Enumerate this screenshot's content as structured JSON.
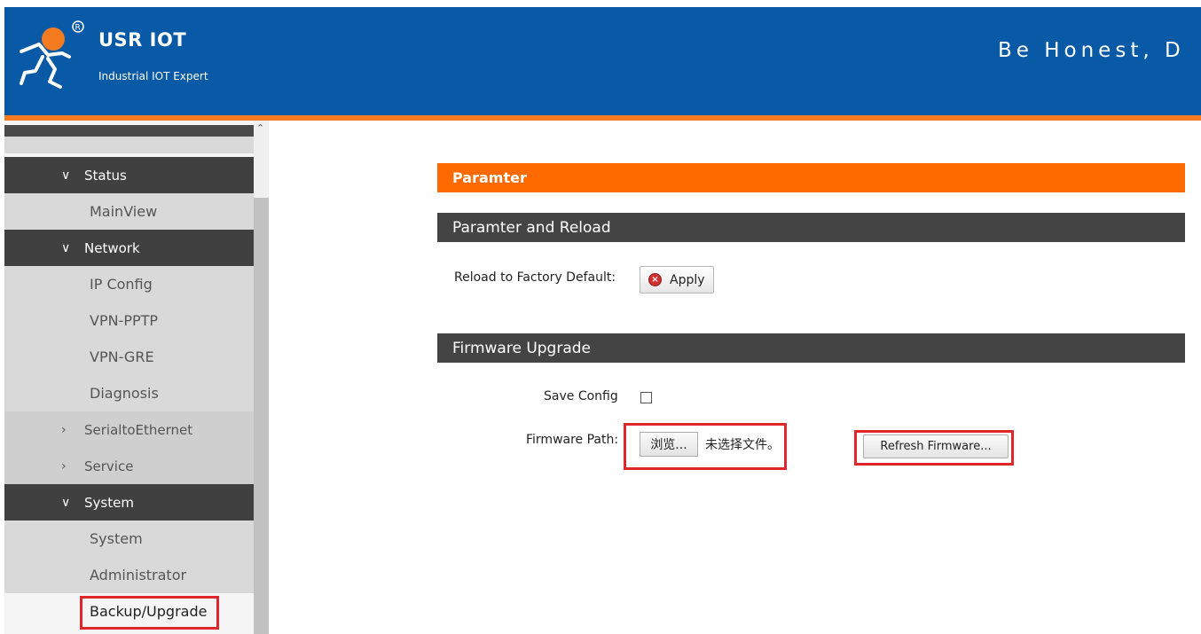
{
  "header": {
    "brand": "USR IOT",
    "tagline": "Industrial IOT Expert",
    "slogan": "Be Honest, D",
    "logo_icon": "usr-iot-logo"
  },
  "colors": {
    "header_bg": "#0859a6",
    "accent_orange": "#ff6a00",
    "section_bar": "#444444",
    "highlight_red": "#e0252b"
  },
  "sidebar": {
    "items": [
      {
        "label": "Status",
        "type": "group",
        "expanded": true,
        "icon": "chevron-down-icon"
      },
      {
        "label": "MainView",
        "type": "child"
      },
      {
        "label": "Network",
        "type": "group",
        "expanded": true,
        "icon": "chevron-down-icon"
      },
      {
        "label": "IP Config",
        "type": "child"
      },
      {
        "label": "VPN-PPTP",
        "type": "child"
      },
      {
        "label": "VPN-GRE",
        "type": "child"
      },
      {
        "label": "Diagnosis",
        "type": "child"
      },
      {
        "label": "SerialtoEthernet",
        "type": "collapsed",
        "icon": "chevron-right-icon"
      },
      {
        "label": "Service",
        "type": "collapsed",
        "icon": "chevron-right-icon"
      },
      {
        "label": "System",
        "type": "group",
        "expanded": true,
        "icon": "chevron-down-icon"
      },
      {
        "label": "System",
        "type": "child"
      },
      {
        "label": "Administrator",
        "type": "child"
      },
      {
        "label": "Backup/Upgrade",
        "type": "child",
        "selected": true
      }
    ]
  },
  "main": {
    "section_title": "Paramter",
    "reload_section": {
      "title": "Paramter and Reload",
      "factory_label": "Reload to Factory Default:",
      "apply_label": "Apply"
    },
    "firmware_section": {
      "title": "Firmware Upgrade",
      "save_config_label": "Save Config",
      "save_config_checked": false,
      "path_label": "Firmware Path:",
      "browse_label": "浏览...",
      "no_file_text": "未选择文件。",
      "refresh_label": "Refresh Firmware..."
    }
  }
}
